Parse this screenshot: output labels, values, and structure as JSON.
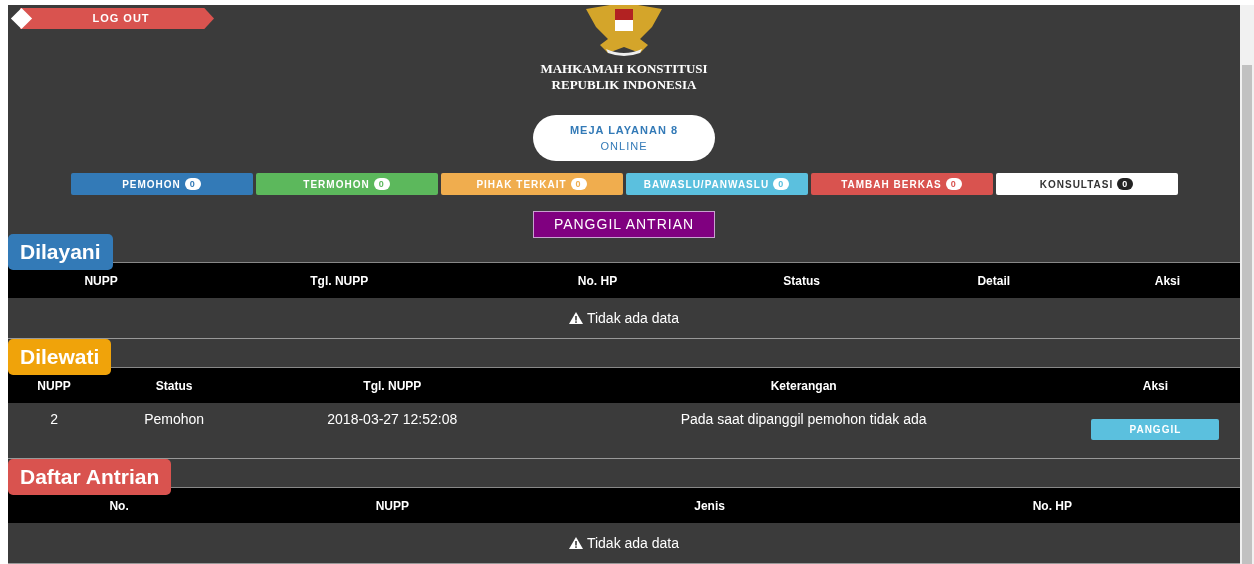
{
  "logout": "LOG OUT",
  "institution": {
    "line1": "MAHKAMAH KONSTITUSI",
    "line2": "REPUBLIK INDONESIA"
  },
  "service_desk": {
    "title": "MEJA LAYANAN 8",
    "status": "ONLINE"
  },
  "categories": [
    {
      "label": "PEMOHON",
      "count": "0",
      "color": "#337ab7"
    },
    {
      "label": "TERMOHON",
      "count": "0",
      "color": "#5cb85c"
    },
    {
      "label": "PIHAK TERKAIT",
      "count": "0",
      "color": "#f0ad4e"
    },
    {
      "label": "BAWASLU/PANWASLU",
      "count": "0",
      "color": "#5bc0de"
    },
    {
      "label": "TAMBAH BERKAS",
      "count": "0",
      "color": "#d9534f"
    },
    {
      "label": "KONSULTASI",
      "count": "0",
      "color": "#ffffff"
    }
  ],
  "call_button": "PANGGIL ANTRIAN",
  "sections": [
    {
      "title": "Dilayani",
      "color": "#337ab7",
      "columns": [
        "NUPP",
        "Tgl. NUPP",
        "No. HP",
        "Status",
        "Detail",
        "Aksi"
      ],
      "empty_message": "Tidak ada data"
    },
    {
      "title": "Dilewati",
      "color": "#f0a30a",
      "columns": [
        "NUPP",
        "Status",
        "Tgl. NUPP",
        "Keterangan",
        "Aksi"
      ],
      "rows": [
        {
          "cells": [
            "2",
            "Pemohon",
            "2018-03-27 12:52:08",
            "Pada saat dipanggil pemohon tidak ada"
          ],
          "action": "PANGGIL"
        }
      ]
    },
    {
      "title": "Daftar Antrian",
      "color": "#d9534f",
      "columns": [
        "No.",
        "NUPP",
        "Jenis",
        "No. HP"
      ],
      "empty_message": "Tidak ada data"
    }
  ]
}
